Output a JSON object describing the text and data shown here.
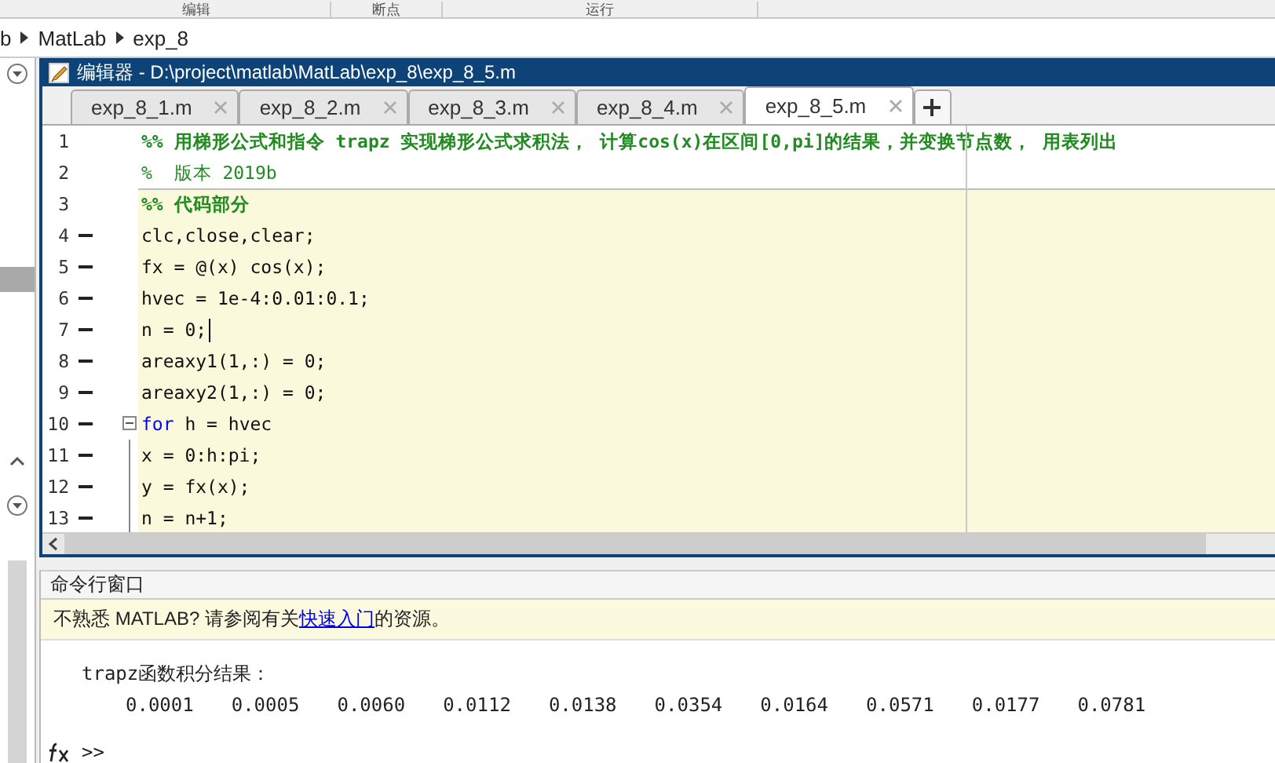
{
  "toolstrip": {
    "sections": [
      "编辑",
      "断点",
      "运行"
    ]
  },
  "address_bar": {
    "segments": [
      "b",
      "MatLab",
      "exp_8"
    ]
  },
  "editor": {
    "title": "编辑器 - D:\\project\\matlab\\MatLab\\exp_8\\exp_8_5.m",
    "tabs": [
      {
        "label": "exp_8_1.m",
        "selected": false
      },
      {
        "label": "exp_8_2.m",
        "selected": false
      },
      {
        "label": "exp_8_3.m",
        "selected": false
      },
      {
        "label": "exp_8_4.m",
        "selected": false
      },
      {
        "label": "exp_8_5.m",
        "selected": true
      }
    ],
    "lines": [
      {
        "number": "1",
        "executable": false,
        "fold_toggle": false,
        "in_block": false,
        "active_cell": false,
        "caret": false,
        "tokens": [
          {
            "kind": "cell_title",
            "text": "%% 用梯形公式和指令 trapz 实现梯形公式求积法， 计算cos(x)在区间[0,pi]的结果，并变换节点数， 用表列出"
          }
        ]
      },
      {
        "number": "2",
        "executable": false,
        "fold_toggle": false,
        "in_block": false,
        "active_cell": false,
        "caret": false,
        "tokens": [
          {
            "kind": "comment",
            "text": "%  版本 2019b"
          }
        ]
      },
      {
        "number": "3",
        "executable": false,
        "fold_toggle": false,
        "in_block": false,
        "active_cell": true,
        "caret": false,
        "tokens": [
          {
            "kind": "cell_title",
            "text": "%% 代码部分"
          }
        ]
      },
      {
        "number": "4",
        "executable": true,
        "fold_toggle": false,
        "in_block": false,
        "active_cell": true,
        "caret": false,
        "tokens": [
          {
            "kind": "plain",
            "text": "clc,close,clear;"
          }
        ]
      },
      {
        "number": "5",
        "executable": true,
        "fold_toggle": false,
        "in_block": false,
        "active_cell": true,
        "caret": false,
        "tokens": [
          {
            "kind": "plain",
            "text": "fx = @(x) cos(x);"
          }
        ]
      },
      {
        "number": "6",
        "executable": true,
        "fold_toggle": false,
        "in_block": false,
        "active_cell": true,
        "caret": false,
        "tokens": [
          {
            "kind": "plain",
            "text": "hvec = 1e-4:0.01:0.1;"
          }
        ]
      },
      {
        "number": "7",
        "executable": true,
        "fold_toggle": false,
        "in_block": false,
        "active_cell": true,
        "caret": true,
        "tokens": [
          {
            "kind": "plain",
            "text": "n = 0;"
          }
        ]
      },
      {
        "number": "8",
        "executable": true,
        "fold_toggle": false,
        "in_block": false,
        "active_cell": true,
        "caret": false,
        "tokens": [
          {
            "kind": "plain",
            "text": "areaxy1(1,:) = 0;"
          }
        ]
      },
      {
        "number": "9",
        "executable": true,
        "fold_toggle": false,
        "in_block": false,
        "active_cell": true,
        "caret": false,
        "tokens": [
          {
            "kind": "plain",
            "text": "areaxy2(1,:) = 0;"
          }
        ]
      },
      {
        "number": "10",
        "executable": true,
        "fold_toggle": true,
        "in_block": false,
        "active_cell": true,
        "caret": false,
        "tokens": [
          {
            "kind": "keyword",
            "text": "for"
          },
          {
            "kind": "plain",
            "text": " h = hvec"
          }
        ]
      },
      {
        "number": "11",
        "executable": true,
        "fold_toggle": false,
        "in_block": true,
        "active_cell": true,
        "caret": false,
        "tokens": [
          {
            "kind": "plain",
            "text": "x = 0:h:pi;"
          }
        ]
      },
      {
        "number": "12",
        "executable": true,
        "fold_toggle": false,
        "in_block": true,
        "active_cell": true,
        "caret": false,
        "tokens": [
          {
            "kind": "plain",
            "text": "y = fx(x);"
          }
        ]
      },
      {
        "number": "13",
        "executable": true,
        "fold_toggle": false,
        "in_block": true,
        "active_cell": true,
        "caret": false,
        "tokens": [
          {
            "kind": "plain",
            "text": "n = n+1;"
          }
        ]
      }
    ]
  },
  "command_window": {
    "title": "命令行窗口",
    "notice": {
      "before": "不熟悉 MATLAB? 请参阅有关",
      "link": "快速入门",
      "after": "的资源。"
    },
    "output_heading": "trapz函数积分结果：",
    "output_values": [
      "0.0001",
      "0.0005",
      "0.0060",
      "0.0112",
      "0.0138",
      "0.0354",
      "0.0164",
      "0.0571",
      "0.0177",
      "0.0781"
    ],
    "prompt": ">>"
  }
}
